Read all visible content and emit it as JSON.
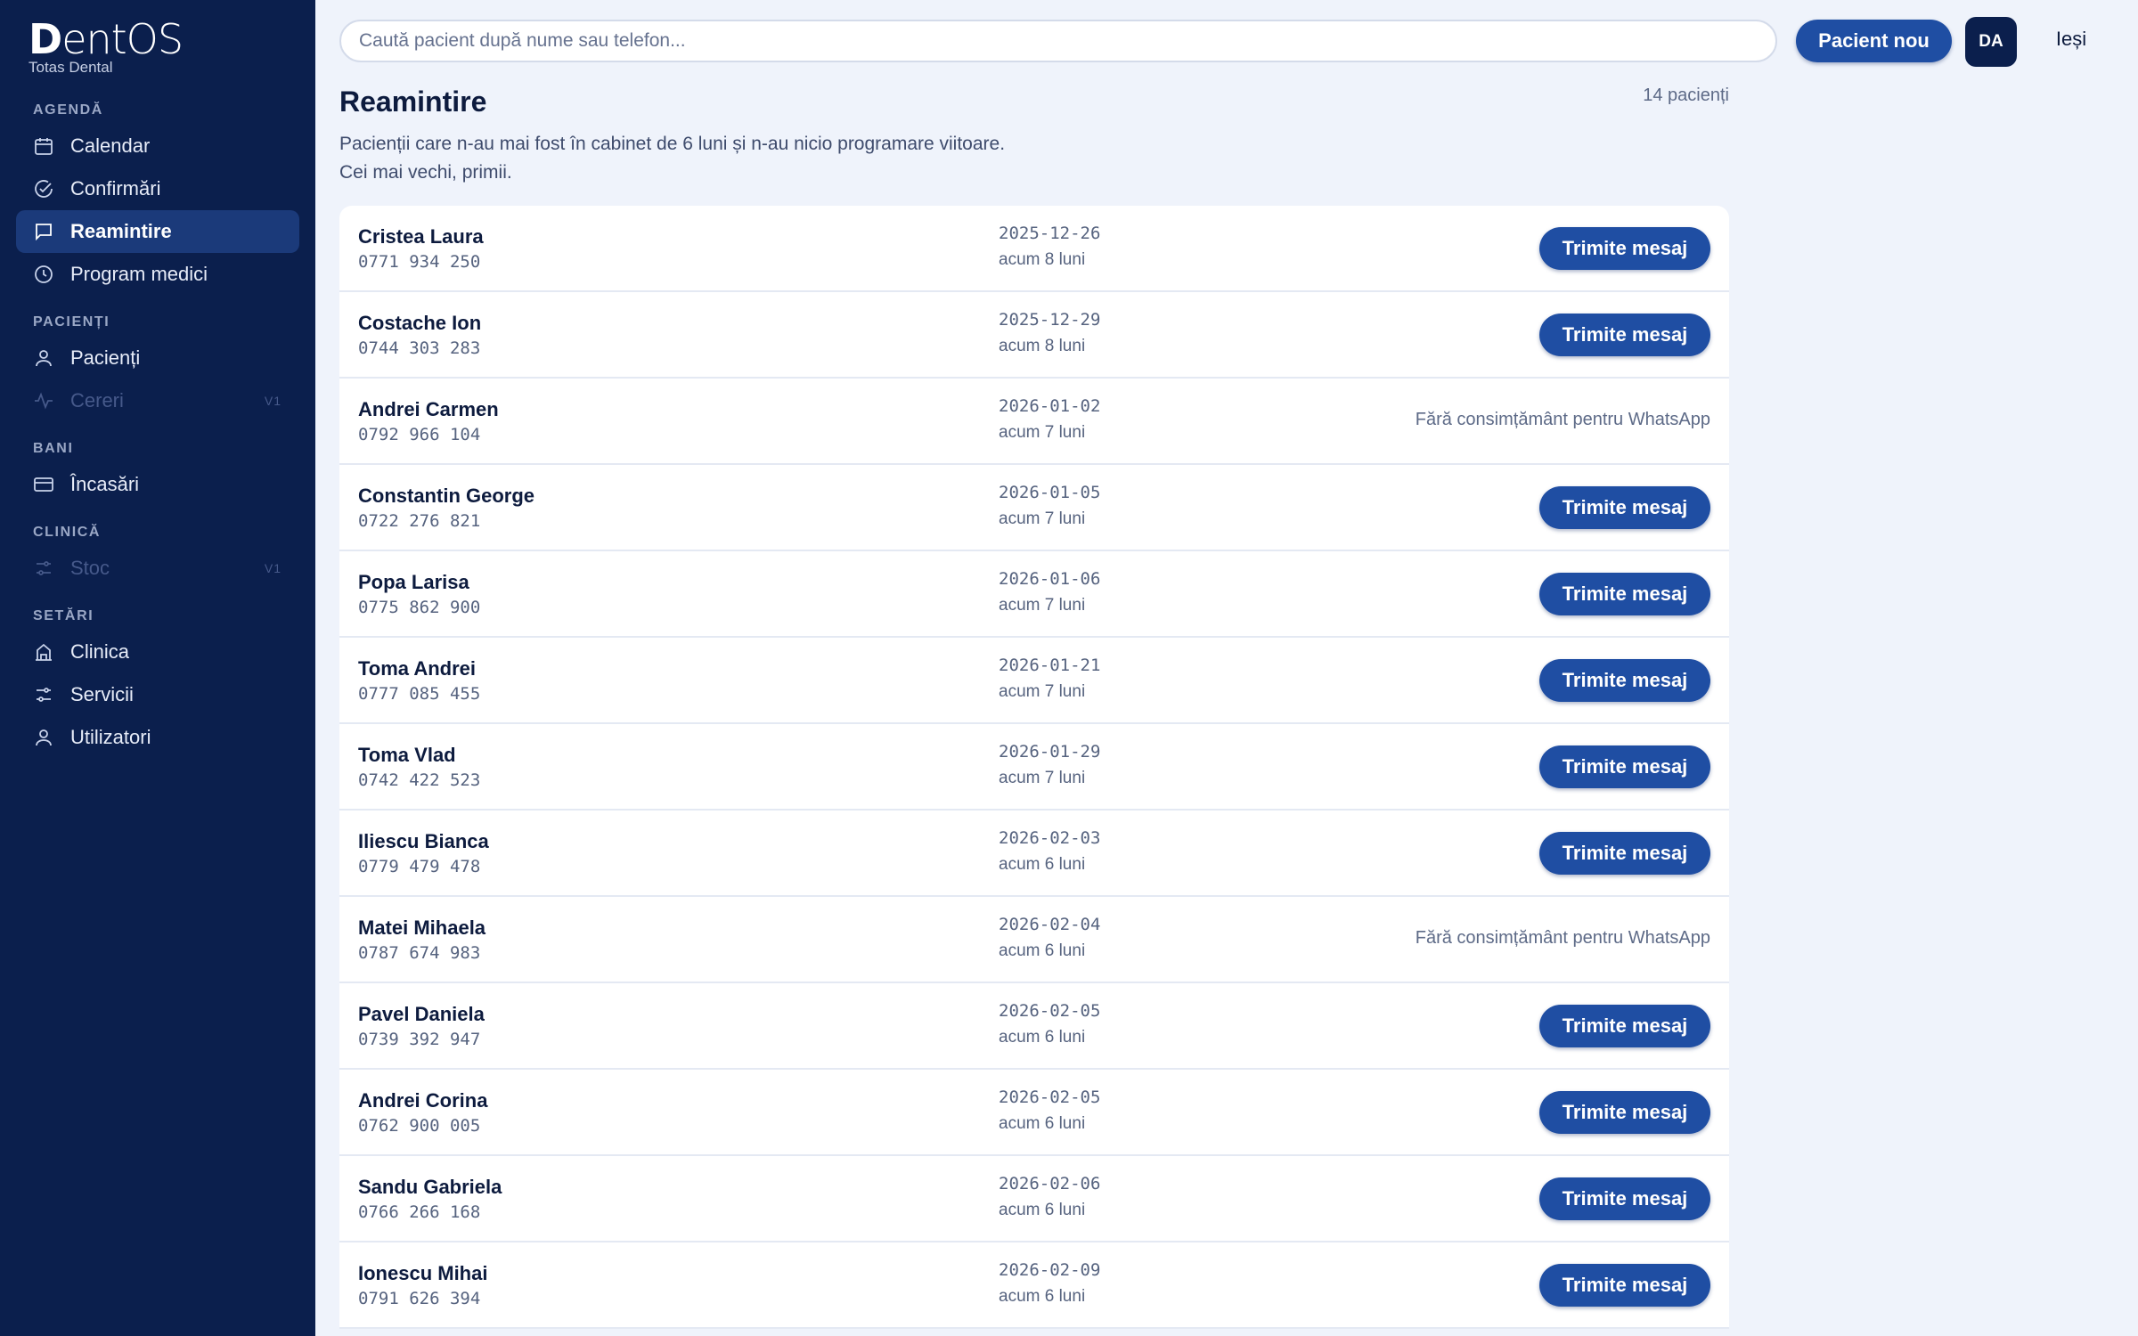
{
  "brand": {
    "logo_a": "D",
    "logo_b": "entOS",
    "clinic": "Totas Dental"
  },
  "nav": {
    "agenda": "AGENDĂ",
    "calendar": "Calendar",
    "confirmari": "Confirmări",
    "reamintire": "Reamintire",
    "program": "Program medici",
    "pacienti_section": "PACIENȚI",
    "pacienti": "Pacienți",
    "cereri": "Cereri",
    "cereri_tag": "V1",
    "bani": "BANI",
    "incasari": "Încasări",
    "clinica_section": "CLINICĂ",
    "stoc": "Stoc",
    "stoc_tag": "V1",
    "setari": "SETĂRI",
    "clinica": "Clinica",
    "servicii": "Servicii",
    "utilizatori": "Utilizatori"
  },
  "topbar": {
    "search_placeholder": "Caută pacient după nume sau telefon...",
    "new_patient": "Pacient nou",
    "avatar": "DA",
    "logout": "Ieși"
  },
  "header": {
    "title": "Reamintire",
    "count": "14 pacienți",
    "desc1": "Pacienții care n-au mai fost în cabinet de 6 luni și n-au nicio programare viitoare.",
    "desc2": "Cei mai vechi, primii."
  },
  "send_label": "Trimite mesaj",
  "noconsent_label": "Fără consimțământ pentru WhatsApp",
  "patients": [
    {
      "name": "Cristea Laura",
      "phone": "0771 934 250",
      "date": "2025-12-26",
      "ago": "acum 8 luni",
      "consent": true
    },
    {
      "name": "Costache Ion",
      "phone": "0744 303 283",
      "date": "2025-12-29",
      "ago": "acum 8 luni",
      "consent": true
    },
    {
      "name": "Andrei Carmen",
      "phone": "0792 966 104",
      "date": "2026-01-02",
      "ago": "acum 7 luni",
      "consent": false
    },
    {
      "name": "Constantin George",
      "phone": "0722 276 821",
      "date": "2026-01-05",
      "ago": "acum 7 luni",
      "consent": true
    },
    {
      "name": "Popa Larisa",
      "phone": "0775 862 900",
      "date": "2026-01-06",
      "ago": "acum 7 luni",
      "consent": true
    },
    {
      "name": "Toma Andrei",
      "phone": "0777 085 455",
      "date": "2026-01-21",
      "ago": "acum 7 luni",
      "consent": true
    },
    {
      "name": "Toma Vlad",
      "phone": "0742 422 523",
      "date": "2026-01-29",
      "ago": "acum 7 luni",
      "consent": true
    },
    {
      "name": "Iliescu Bianca",
      "phone": "0779 479 478",
      "date": "2026-02-03",
      "ago": "acum 6 luni",
      "consent": true
    },
    {
      "name": "Matei Mihaela",
      "phone": "0787 674 983",
      "date": "2026-02-04",
      "ago": "acum 6 luni",
      "consent": false
    },
    {
      "name": "Pavel Daniela",
      "phone": "0739 392 947",
      "date": "2026-02-05",
      "ago": "acum 6 luni",
      "consent": true
    },
    {
      "name": "Andrei Corina",
      "phone": "0762 900 005",
      "date": "2026-02-05",
      "ago": "acum 6 luni",
      "consent": true
    },
    {
      "name": "Sandu Gabriela",
      "phone": "0766 266 168",
      "date": "2026-02-06",
      "ago": "acum 6 luni",
      "consent": true
    },
    {
      "name": "Ionescu Mihai",
      "phone": "0791 626 394",
      "date": "2026-02-09",
      "ago": "acum 6 luni",
      "consent": true
    }
  ]
}
